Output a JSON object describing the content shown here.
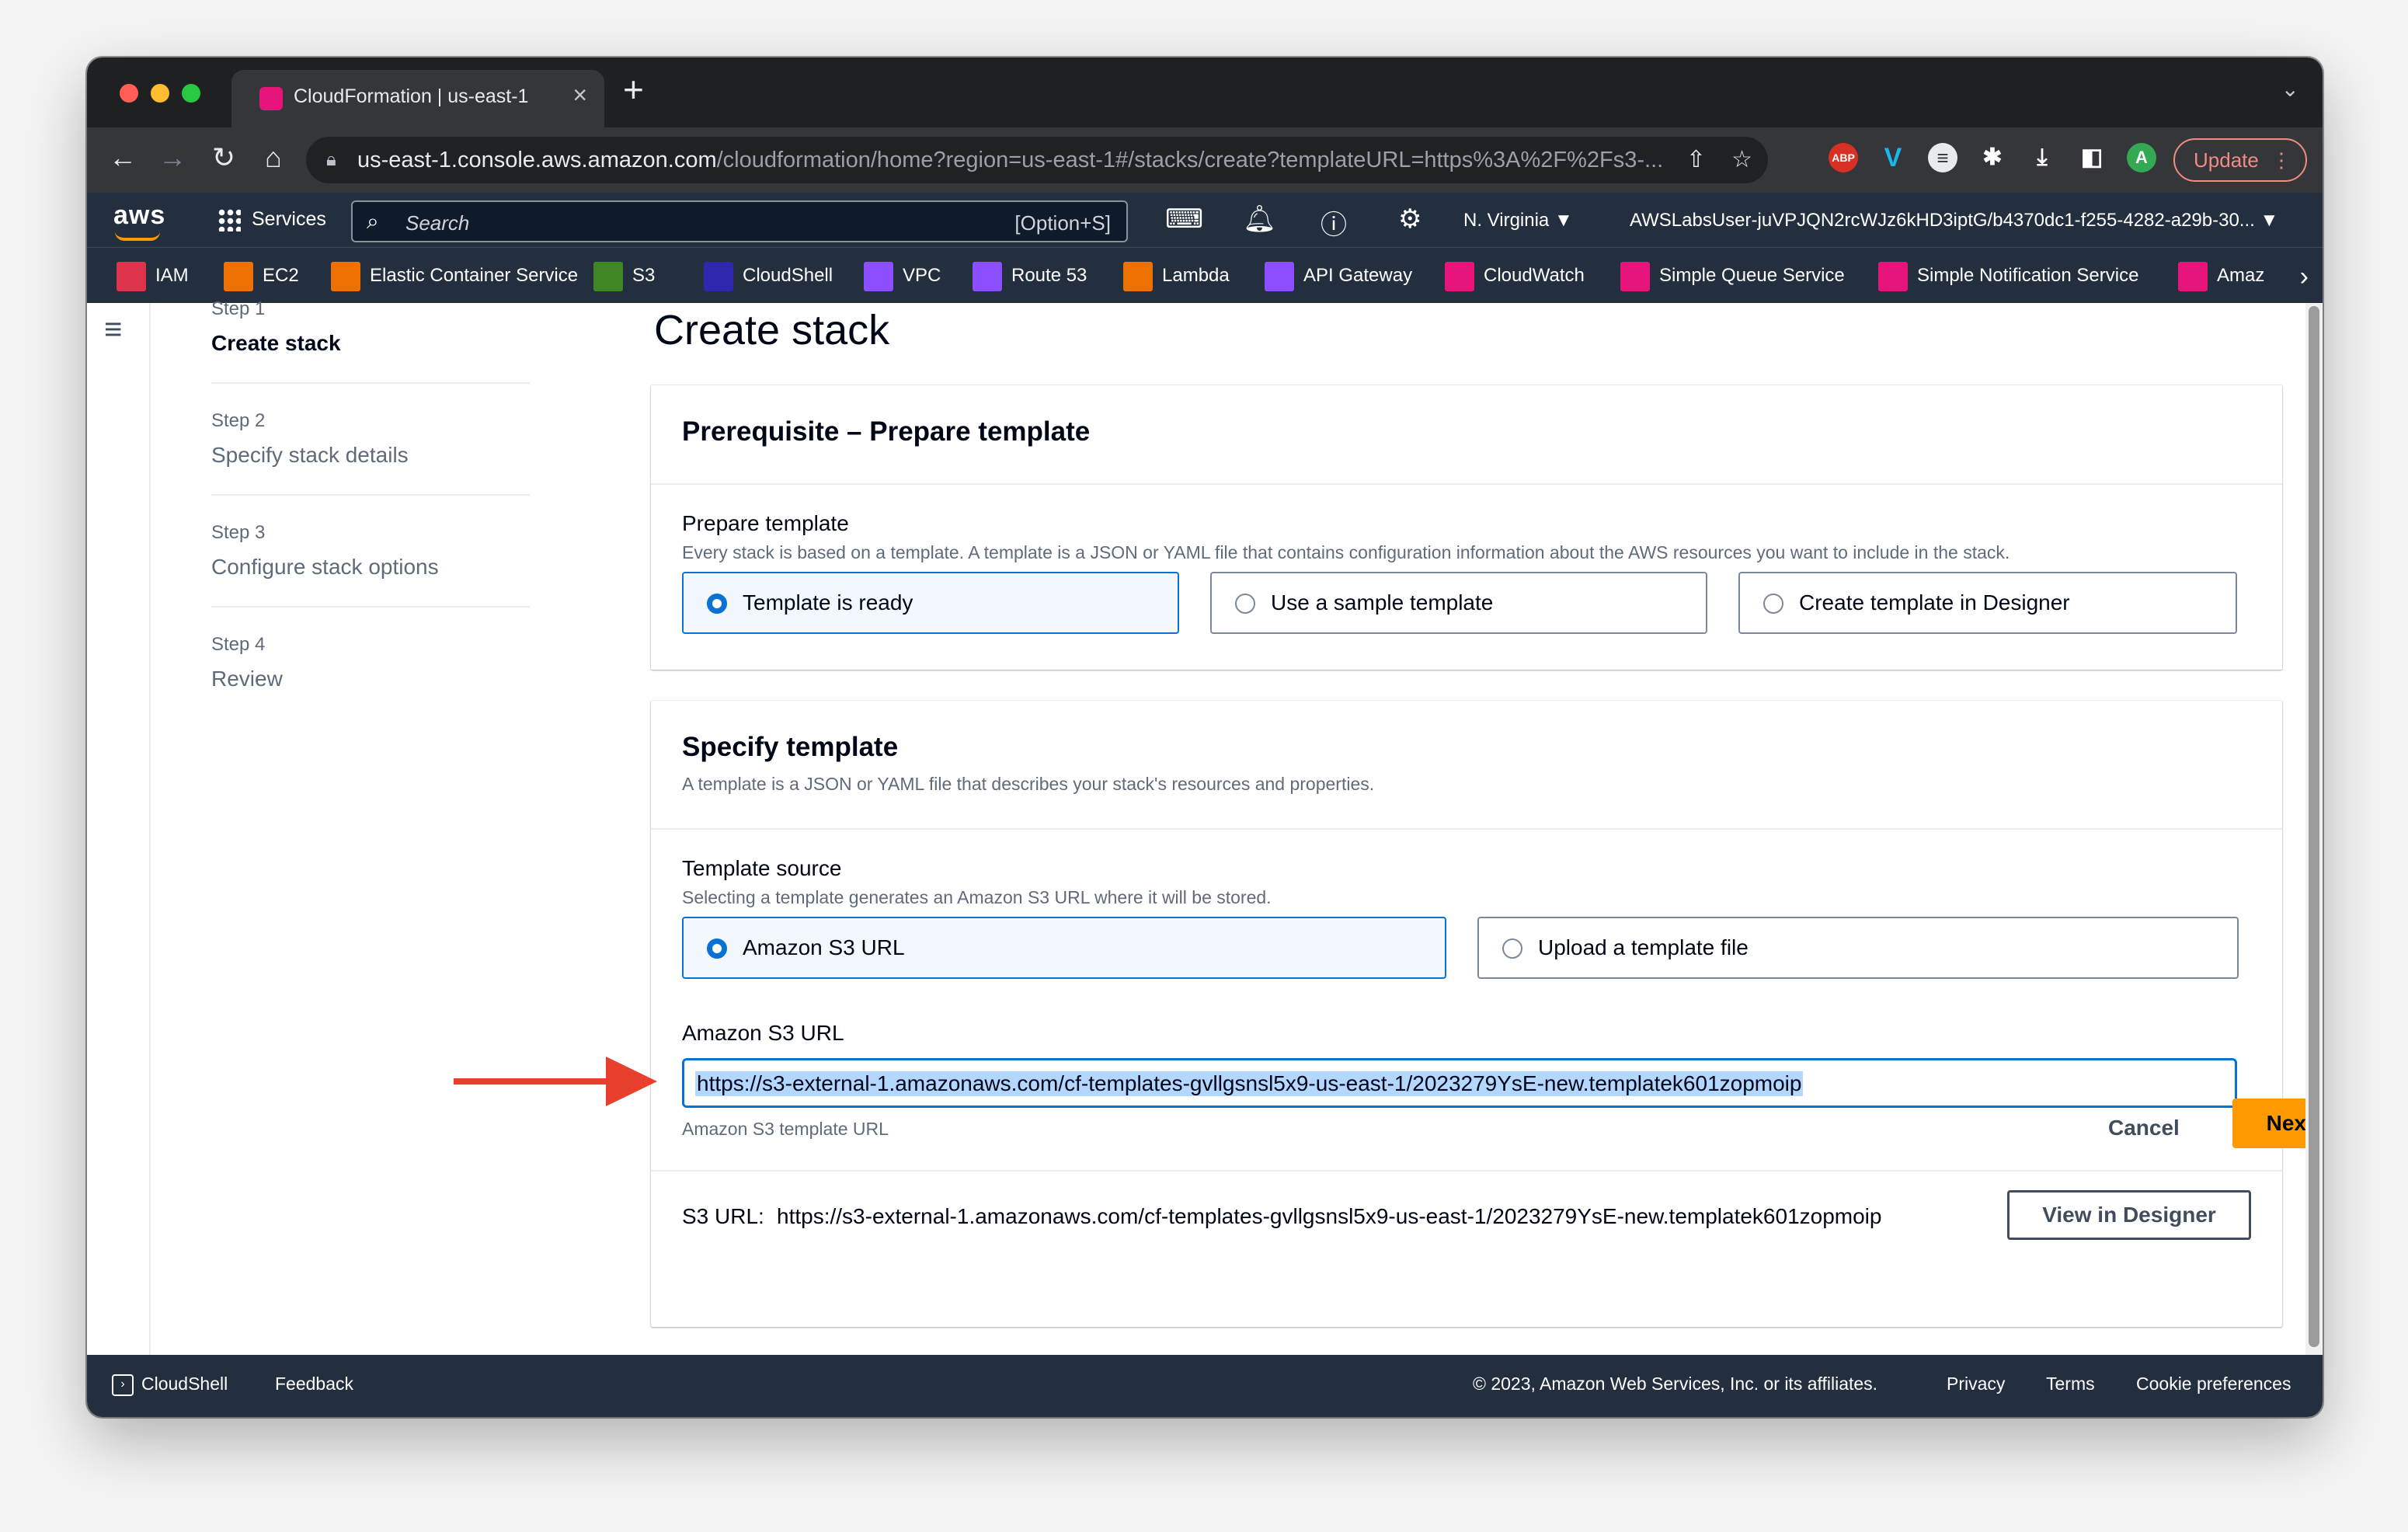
{
  "browser": {
    "tab_title": "CloudFormation | us-east-1",
    "tab_close": "×",
    "new_tab": "+",
    "url_host": "us-east-1.console.aws.amazon.com",
    "url_path": "/cloudformation/home?region=us-east-1#/stacks/create?templateURL=https%3A%2F%2Fs3-...",
    "update_label": "Update",
    "profile_initial": "A",
    "adblock_label": "ABP"
  },
  "console": {
    "logo": "aws",
    "services_label": "Services",
    "search_placeholder": "Search",
    "search_shortcut": "[Option+S]",
    "region": "N. Virginia ▼",
    "account": "AWSLabsUser-juVPJQN2rcWJz6kHD3iptG/b4370dc1-f255-4282-a29b-30... ▼"
  },
  "favorites": [
    {
      "label": "IAM",
      "color": "#dd344c"
    },
    {
      "label": "EC2",
      "color": "#ed7100"
    },
    {
      "label": "Elastic Container Service",
      "color": "#ed7100"
    },
    {
      "label": "S3",
      "color": "#3f8624"
    },
    {
      "label": "CloudShell",
      "color": "#2e27ad"
    },
    {
      "label": "VPC",
      "color": "#8c4fff"
    },
    {
      "label": "Route 53",
      "color": "#8c4fff"
    },
    {
      "label": "Lambda",
      "color": "#ed7100"
    },
    {
      "label": "API Gateway",
      "color": "#8c4fff"
    },
    {
      "label": "CloudWatch",
      "color": "#e7157b"
    },
    {
      "label": "Simple Queue Service",
      "color": "#e7157b"
    },
    {
      "label": "Simple Notification Service",
      "color": "#e7157b"
    },
    {
      "label": "Amaz",
      "color": "#e7157b"
    }
  ],
  "steps": [
    {
      "num": "Step 1",
      "title": "Create stack"
    },
    {
      "num": "Step 2",
      "title": "Specify stack details"
    },
    {
      "num": "Step 3",
      "title": "Configure stack options"
    },
    {
      "num": "Step 4",
      "title": "Review"
    }
  ],
  "page_title": "Create stack",
  "prerequisite": {
    "title": "Prerequisite – Prepare template",
    "field_label": "Prepare template",
    "field_desc": "Every stack is based on a template. A template is a JSON or YAML file that contains configuration information about the AWS resources you want to include in the stack.",
    "options": [
      "Template is ready",
      "Use a sample template",
      "Create template in Designer"
    ]
  },
  "specify": {
    "title": "Specify template",
    "desc": "A template is a JSON or YAML file that describes your stack's resources and properties.",
    "source_label": "Template source",
    "source_desc": "Selecting a template generates an Amazon S3 URL where it will be stored.",
    "options": [
      "Amazon S3 URL",
      "Upload a template file"
    ],
    "url_label": "Amazon S3 URL",
    "url_value": "https://s3-external-1.amazonaws.com/cf-templates-gvllgsnsl5x9-us-east-1/2023279YsE-new.templatek601zopmoip",
    "url_hint": "Amazon S3 template URL",
    "s3url_label": "S3 URL:",
    "s3url_value": "https://s3-external-1.amazonaws.com/cf-templates-gvllgsnsl5x9-us-east-1/2023279YsE-new.templatek601zopmoip",
    "view_designer": "View in Designer"
  },
  "actions": {
    "cancel": "Cancel",
    "next": "Next"
  },
  "footer": {
    "cloudshell": "CloudShell",
    "feedback": "Feedback",
    "copyright": "© 2023, Amazon Web Services, Inc. or its affiliates.",
    "privacy": "Privacy",
    "terms": "Terms",
    "cookies": "Cookie preferences"
  },
  "colors": {
    "accent": "#0972d3",
    "primary_button": "#ff9900",
    "nav_bg": "#232f3e",
    "annotation_arrow": "#e8402c"
  }
}
